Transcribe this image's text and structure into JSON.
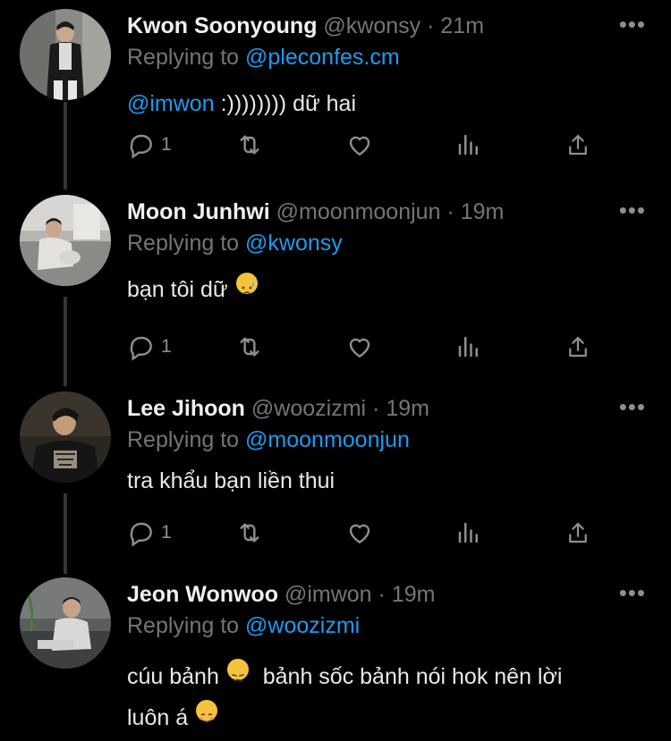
{
  "tweets": [
    {
      "name": "Kwon Soonyoung",
      "handle": "@kwonsy",
      "time": "21m",
      "replying_prefix": "Replying to",
      "replying_to": "@pleconfes.cm",
      "text_mention": "@imwon",
      "text": " :)))))))) dữ hai",
      "reply_count": "1",
      "avatar": "person-in-leather-jacket"
    },
    {
      "name": "Moon Junhwi",
      "handle": "@moonmoonjun",
      "time": "19m",
      "replying_prefix": "Replying to",
      "replying_to": "@kwonsy",
      "text": "bạn tôi dữ",
      "text_emoji": "sad-sweat-face",
      "reply_count": "1",
      "avatar": "person-on-sofa"
    },
    {
      "name": "Lee Jihoon",
      "handle": "@woozizmi",
      "time": "19m",
      "replying_prefix": "Replying to",
      "replying_to": "@moonmoonjun",
      "text": "tra khẩu bạn liền thui",
      "reply_count": "1",
      "avatar": "person-in-dark-shirt"
    },
    {
      "name": "Jeon Wonwoo",
      "handle": "@imwon",
      "time": "19m",
      "replying_prefix": "Replying to",
      "replying_to": "@woozizmi",
      "text_line1_a": "cúu bảnh",
      "text_line1_b": "bảnh sốc bảnh nói hok nên lời",
      "text_line2": "luôn á",
      "emoji_1": "disappointed-face",
      "emoji_2": "smiling-blush-face",
      "avatar": "person-on-couch"
    }
  ],
  "separator": "·",
  "more_glyph": "•••",
  "icons": [
    "reply-icon",
    "retweet-icon",
    "like-icon",
    "analytics-icon",
    "share-icon",
    "more-icon"
  ],
  "colors": {
    "background": "#000000",
    "link": "#1d9bf0",
    "muted": "#71767b"
  }
}
